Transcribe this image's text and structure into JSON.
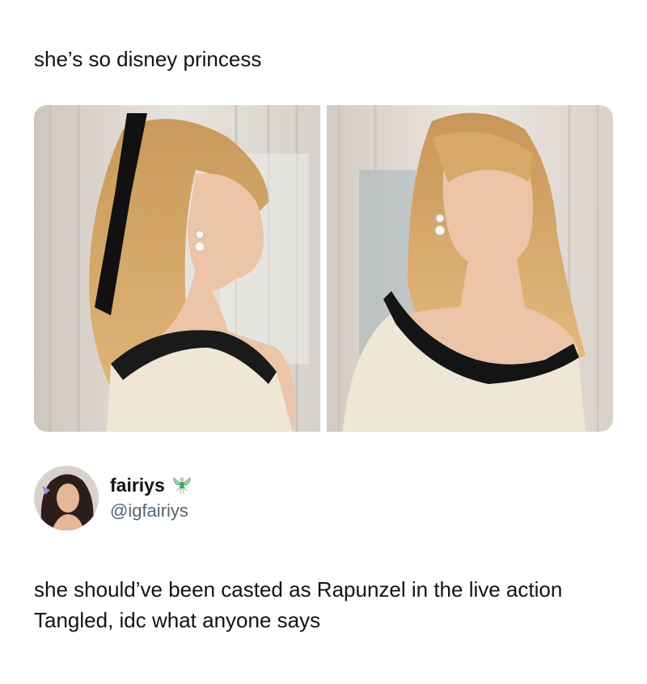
{
  "caption": "she’s so disney princess",
  "post": {
    "display_name": "fairiys",
    "handle": "@igfairiys",
    "badge_icon": "fairy-icon",
    "text": "she should’ve been casted as Rapunzel in the live action Tangled, idc what anyone says"
  },
  "colors": {
    "handle": "#536471",
    "text": "#0f1419"
  }
}
